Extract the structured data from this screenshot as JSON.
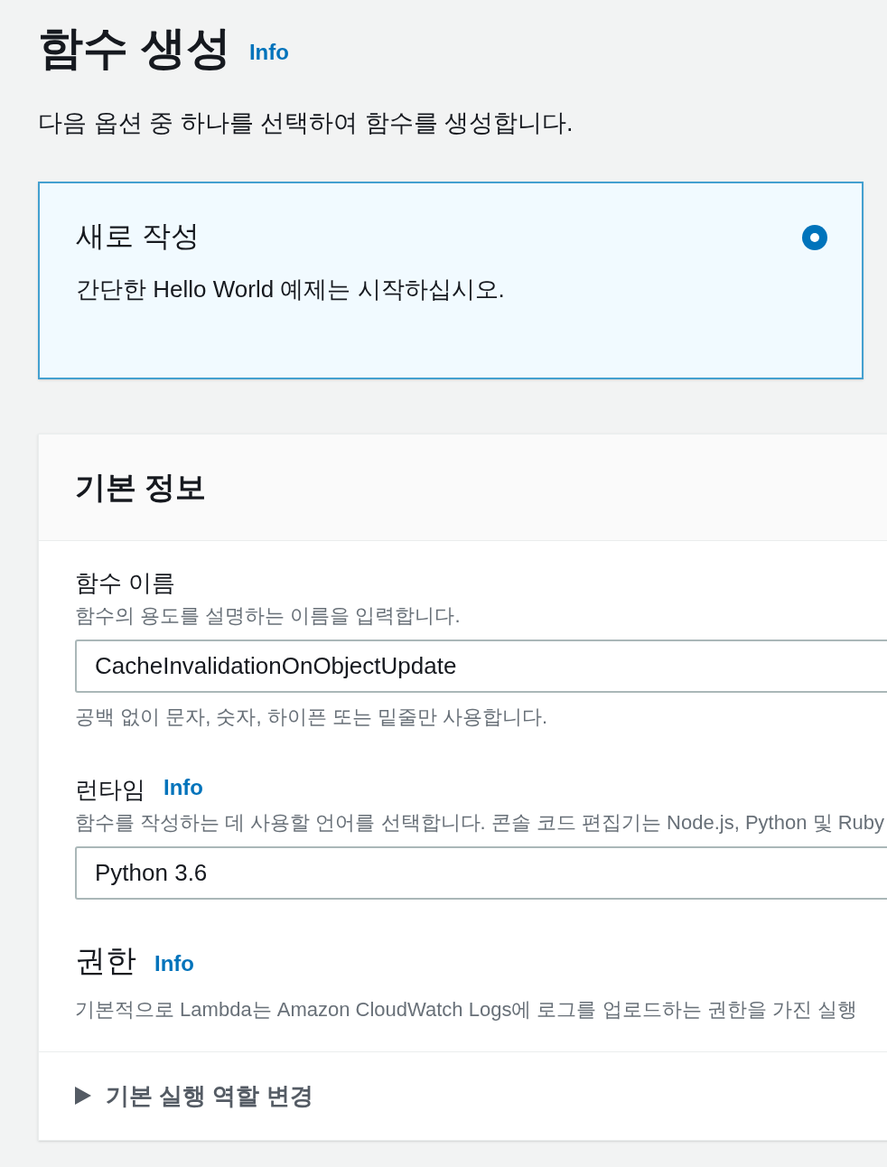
{
  "page": {
    "title": "함수 생성",
    "info_link": "Info",
    "description": "다음 옵션 중 하나를 선택하여 함수를 생성합니다."
  },
  "options": [
    {
      "title": "새로 작성",
      "description": "간단한 Hello World 예제는 시작하십시오.",
      "selected": true
    }
  ],
  "basic_info": {
    "title": "기본 정보",
    "fields": [
      {
        "kind": "input",
        "label": "함수 이름",
        "description": "함수의 용도를 설명하는 이름을 입력합니다.",
        "value": "CacheInvalidationOnObjectUpdate",
        "constraint": "공백 없이 문자, 숫자, 하이픈 또는 밑줄만 사용합니다."
      },
      {
        "kind": "select",
        "label": "런타임",
        "info_link": "Info",
        "description": "함수를 작성하는 데 사용할 언어를 선택합니다. 콘솔 코드 편집기는 Node.js, Python 및 Ruby",
        "value": "Python 3.6"
      },
      {
        "kind": "text",
        "label": "권한",
        "info_link": "Info",
        "description": "기본적으로 Lambda는 Amazon CloudWatch Logs에 로그를 업로드하는 권한을 가진 실행"
      }
    ],
    "expander": {
      "label": "기본 실행 역할 변경",
      "expanded": false
    }
  }
}
